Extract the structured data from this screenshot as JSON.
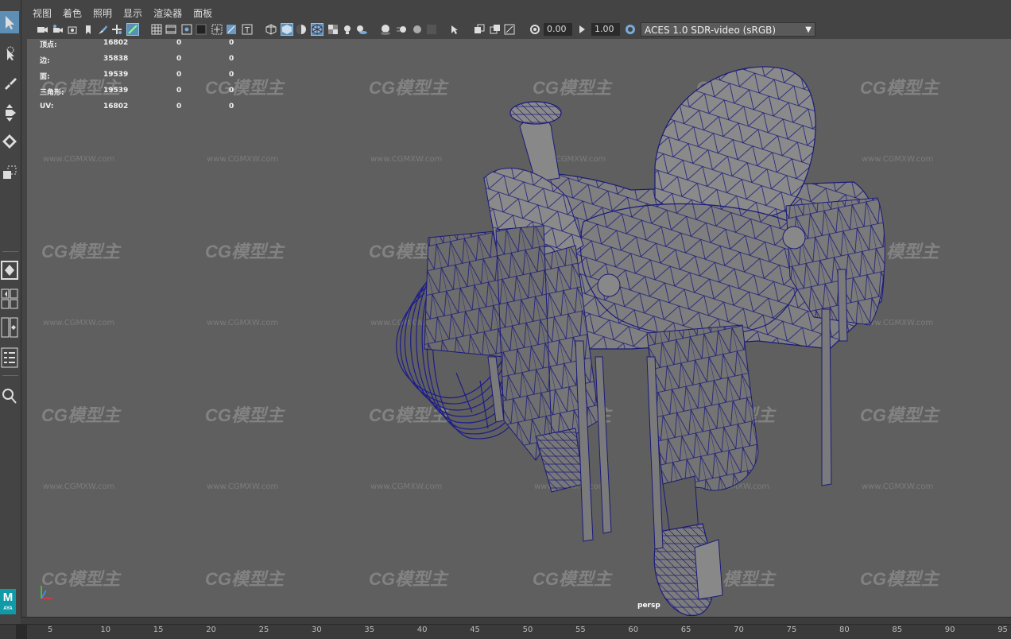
{
  "menu": {
    "items": [
      "视图",
      "着色",
      "照明",
      "显示",
      "渲染器",
      "面板"
    ]
  },
  "iconbar": {
    "field1": "0.00",
    "field2": "1.00",
    "color_space": "ACES 1.0 SDR-video (sRGB)"
  },
  "hud": {
    "rows": [
      {
        "label": "顶点:",
        "v1": "16802",
        "v2": "0",
        "v3": "0"
      },
      {
        "label": "边:",
        "v1": "35838",
        "v2": "0",
        "v3": "0"
      },
      {
        "label": "面:",
        "v1": "19539",
        "v2": "0",
        "v3": "0"
      },
      {
        "label": "三角形:",
        "v1": "19539",
        "v2": "0",
        "v3": "0"
      },
      {
        "label": "UV:",
        "v1": "16802",
        "v2": "0",
        "v3": "0"
      }
    ]
  },
  "viewport": {
    "camera": "persp",
    "watermark_logo": "CG模型主",
    "watermark_url": "www.CGMXW.com",
    "axis": {
      "x": "X",
      "y": "Y",
      "z": "Z"
    }
  },
  "logo": {
    "letter": "M",
    "sub": "AYA"
  },
  "timeline": {
    "ticks": [
      "5",
      "10",
      "15",
      "20",
      "25",
      "30",
      "35",
      "40",
      "45",
      "50",
      "55",
      "60",
      "65",
      "70",
      "75",
      "80",
      "85",
      "90",
      "95"
    ]
  },
  "colors": {
    "wire": "#1a1a7a",
    "viewport_bg": "#5f5f5f",
    "active_tool": "#5d8fb6"
  }
}
